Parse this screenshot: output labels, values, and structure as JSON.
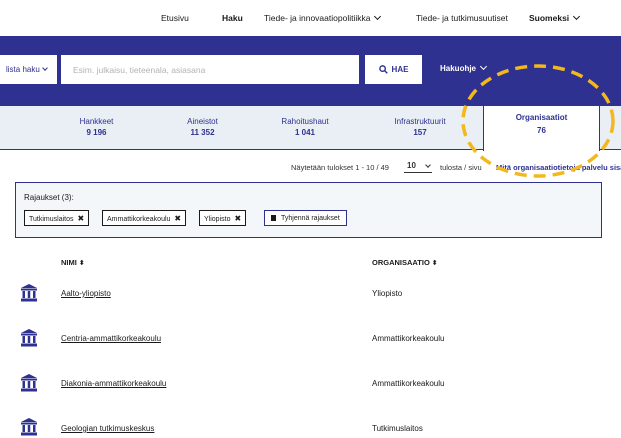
{
  "nav": {
    "items": [
      {
        "label": "Etusivu"
      },
      {
        "label": "Haku"
      },
      {
        "label": "Tiede- ja innovaatiopolitiikka"
      },
      {
        "label": "Tiede- ja tutkimusuutiset"
      },
      {
        "label": "Suomeksi"
      }
    ]
  },
  "search": {
    "scope_label": "lista haku",
    "placeholder": "Esim. julkaisu, tieteenala, asiasana",
    "button_label": "HAE",
    "help_label": "Hakuohje"
  },
  "tabs": [
    {
      "label": "Hankkeet",
      "count": "9 196"
    },
    {
      "label": "Aineistot",
      "count": "11 352"
    },
    {
      "label": "Rahoitushaut",
      "count": "1 041"
    },
    {
      "label": "Infrastruktuurit",
      "count": "157"
    },
    {
      "label": "Organisaatiot",
      "count": "76"
    }
  ],
  "results": {
    "shown": "Näytetään tulokset 1 - 10 / 49",
    "per_page": "10",
    "per_page_suffix": "tulosta / sivu",
    "info_link": "Mitä organisaatiotietoja palvelu sisältää?"
  },
  "filters": {
    "title": "Rajaukset (3):",
    "chips": [
      {
        "label": "Tutkimuslaitos"
      },
      {
        "label": "Ammattikorkeakoulu"
      },
      {
        "label": "Yliopisto"
      }
    ],
    "clear_label": "Tyhjennä rajaukset"
  },
  "table": {
    "columns": [
      "NIMI",
      "ORGANISAATIO"
    ],
    "rows": [
      {
        "name": "Aalto-yliopisto",
        "type": "Yliopisto"
      },
      {
        "name": "Centria-ammattikorkeakoulu",
        "type": "Ammattikorkeakoulu"
      },
      {
        "name": "Diakonia-ammattikorkeakoulu",
        "type": "Ammattikorkeakoulu"
      },
      {
        "name": "Geologian tutkimuskeskus",
        "type": "Tutkimuslaitos"
      }
    ]
  },
  "colors": {
    "brand": "#2e318f",
    "tab_band": "#e9eff5",
    "highlight": "#f2b81c"
  }
}
